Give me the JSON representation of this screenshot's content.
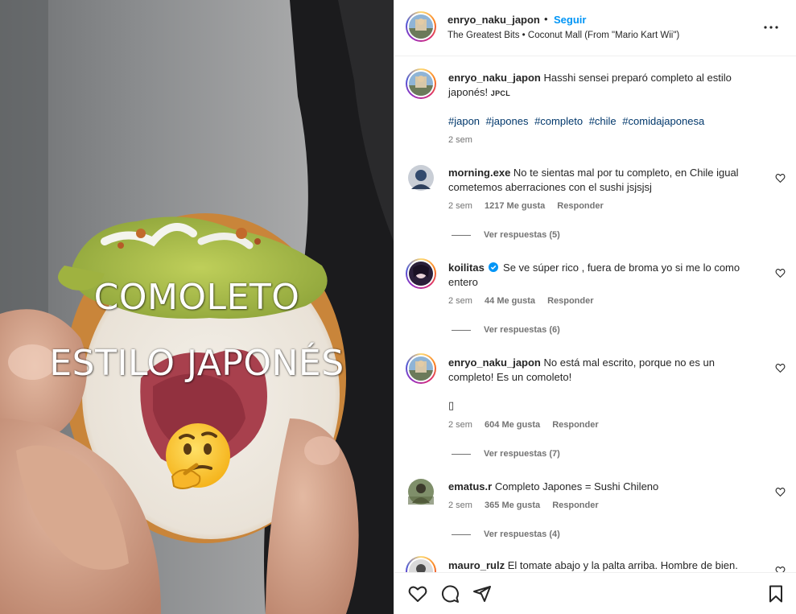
{
  "media": {
    "overlay_line1": "COMOLETO",
    "overlay_line2": "ESTILO JAPONÉS",
    "emoji": "thinking-face"
  },
  "header": {
    "username": "enryo_naku_japon",
    "dot": "•",
    "follow_label": "Seguir",
    "audio": "The Greatest Bits • Coconut Mall (From \"Mario Kart Wii\")",
    "more_icon": "more-options-icon"
  },
  "caption": {
    "username": "enryo_naku_japon",
    "text": "Hasshi sensei preparó completo al estilo japonés!",
    "signature": "JPCL",
    "hashtags": [
      "#japon",
      "#japones",
      "#completo",
      "#chile",
      "#comidajaponesa"
    ],
    "time": "2 sem"
  },
  "comments": [
    {
      "username": "morning.exe",
      "text": "No te sientas mal por tu completo, en Chile igual cometemos aberraciones con el sushi jsjsjsj",
      "time": "2 sem",
      "likes": "1217 Me gusta",
      "reply": "Responder",
      "view_replies": "Ver respuestas (5)"
    },
    {
      "username": "koilitas",
      "verified": true,
      "text": "Se ve súper rico , fuera de broma yo si me lo como entero",
      "time": "2 sem",
      "likes": "44 Me gusta",
      "reply": "Responder",
      "view_replies": "Ver respuestas (6)"
    },
    {
      "username": "enryo_naku_japon",
      "text": "No está mal escrito, porque no es un completo! Es un comoleto!",
      "extra": "▯",
      "time": "2 sem",
      "likes": "604 Me gusta",
      "reply": "Responder",
      "view_replies": "Ver respuestas (7)"
    },
    {
      "username": "ematus.r",
      "text": "Completo Japones = Sushi Chileno",
      "time": "2 sem",
      "likes": "365 Me gusta",
      "reply": "Responder",
      "view_replies": "Ver respuestas (4)"
    },
    {
      "username": "mauro_rulz",
      "text": "El tomate abajo y la palta arriba. Hombre de bien."
    }
  ],
  "actions": [
    "like-icon",
    "comment-icon",
    "share-icon",
    "save-icon"
  ],
  "colors": {
    "accent": "#0095f6",
    "hashtag": "#00376b",
    "muted": "#737373",
    "text": "#262626"
  }
}
